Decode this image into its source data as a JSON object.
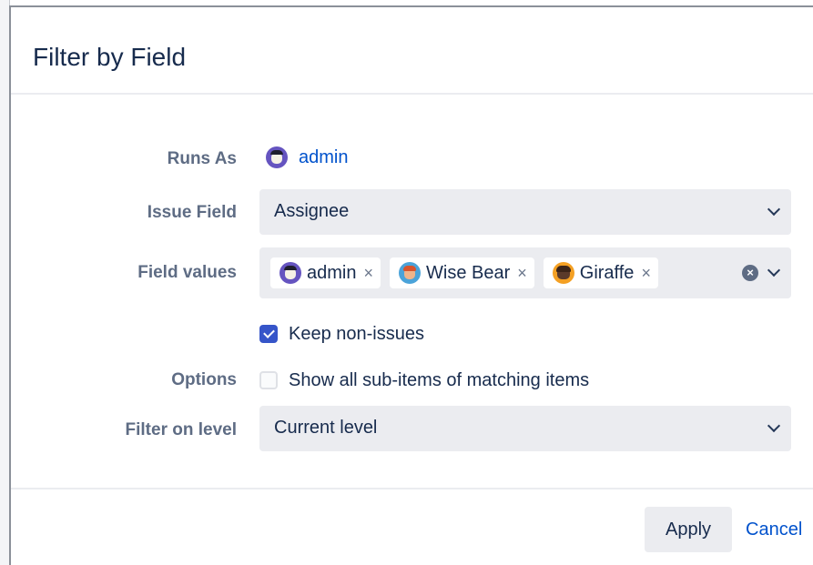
{
  "dialog": {
    "title": "Filter by Field"
  },
  "runs_as": {
    "label": "Runs As",
    "user": "admin"
  },
  "issue_field": {
    "label": "Issue Field",
    "selected": "Assignee"
  },
  "field_values": {
    "label": "Field values",
    "tags": [
      {
        "label": "admin",
        "remove": "×",
        "avatar": "admin-avatar"
      },
      {
        "label": "Wise Bear",
        "remove": "×",
        "avatar": "bear-avatar"
      },
      {
        "label": "Giraffe",
        "remove": "×",
        "avatar": "giraffe-avatar"
      }
    ],
    "clear_glyph": "×"
  },
  "options": {
    "label": "Options",
    "keep_non_issues": {
      "label": "Keep non-issues",
      "checked": true
    },
    "show_sub_items": {
      "label": "Show all sub-items of matching items",
      "checked": false
    }
  },
  "filter_on_level": {
    "label": "Filter on level",
    "selected": "Current level"
  },
  "footer": {
    "apply_label": "Apply",
    "cancel_label": "Cancel"
  },
  "colors": {
    "accent": "#3655c9",
    "link": "#0052cc",
    "field_bg": "#ebecf0",
    "label_text": "#5e6c84"
  }
}
